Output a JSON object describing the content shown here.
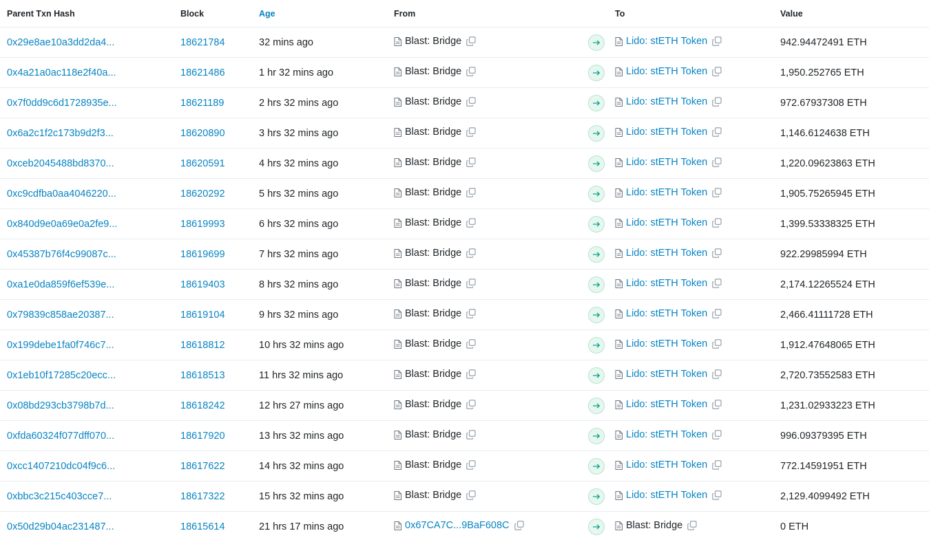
{
  "table": {
    "headers": {
      "hash": "Parent Txn Hash",
      "block": "Block",
      "age": "Age",
      "from": "From",
      "to": "To",
      "value": "Value"
    },
    "rows": [
      {
        "hash": "0x29e8ae10a3dd2da4...",
        "block": "18621784",
        "age": "32 mins ago",
        "from": "Blast: Bridge",
        "from_is_link": false,
        "to": "Lido: stETH Token",
        "to_is_link": true,
        "value": "942.94472491 ETH"
      },
      {
        "hash": "0x4a21a0ac118e2f40a...",
        "block": "18621486",
        "age": "1 hr 32 mins ago",
        "from": "Blast: Bridge",
        "from_is_link": false,
        "to": "Lido: stETH Token",
        "to_is_link": true,
        "value": "1,950.252765 ETH"
      },
      {
        "hash": "0x7f0dd9c6d1728935e...",
        "block": "18621189",
        "age": "2 hrs 32 mins ago",
        "from": "Blast: Bridge",
        "from_is_link": false,
        "to": "Lido: stETH Token",
        "to_is_link": true,
        "value": "972.67937308 ETH"
      },
      {
        "hash": "0x6a2c1f2c173b9d2f3...",
        "block": "18620890",
        "age": "3 hrs 32 mins ago",
        "from": "Blast: Bridge",
        "from_is_link": false,
        "to": "Lido: stETH Token",
        "to_is_link": true,
        "value": "1,146.6124638 ETH"
      },
      {
        "hash": "0xceb2045488bd8370...",
        "block": "18620591",
        "age": "4 hrs 32 mins ago",
        "from": "Blast: Bridge",
        "from_is_link": false,
        "to": "Lido: stETH Token",
        "to_is_link": true,
        "value": "1,220.09623863 ETH"
      },
      {
        "hash": "0xc9cdfba0aa4046220...",
        "block": "18620292",
        "age": "5 hrs 32 mins ago",
        "from": "Blast: Bridge",
        "from_is_link": false,
        "to": "Lido: stETH Token",
        "to_is_link": true,
        "value": "1,905.75265945 ETH"
      },
      {
        "hash": "0x840d9e0a69e0a2fe9...",
        "block": "18619993",
        "age": "6 hrs 32 mins ago",
        "from": "Blast: Bridge",
        "from_is_link": false,
        "to": "Lido: stETH Token",
        "to_is_link": true,
        "value": "1,399.53338325 ETH"
      },
      {
        "hash": "0x45387b76f4c99087c...",
        "block": "18619699",
        "age": "7 hrs 32 mins ago",
        "from": "Blast: Bridge",
        "from_is_link": false,
        "to": "Lido: stETH Token",
        "to_is_link": true,
        "value": "922.29985994 ETH"
      },
      {
        "hash": "0xa1e0da859f6ef539e...",
        "block": "18619403",
        "age": "8 hrs 32 mins ago",
        "from": "Blast: Bridge",
        "from_is_link": false,
        "to": "Lido: stETH Token",
        "to_is_link": true,
        "value": "2,174.12265524 ETH"
      },
      {
        "hash": "0x79839c858ae20387...",
        "block": "18619104",
        "age": "9 hrs 32 mins ago",
        "from": "Blast: Bridge",
        "from_is_link": false,
        "to": "Lido: stETH Token",
        "to_is_link": true,
        "value": "2,466.41111728 ETH"
      },
      {
        "hash": "0x199debe1fa0f746c7...",
        "block": "18618812",
        "age": "10 hrs 32 mins ago",
        "from": "Blast: Bridge",
        "from_is_link": false,
        "to": "Lido: stETH Token",
        "to_is_link": true,
        "value": "1,912.47648065 ETH"
      },
      {
        "hash": "0x1eb10f17285c20ecc...",
        "block": "18618513",
        "age": "11 hrs 32 mins ago",
        "from": "Blast: Bridge",
        "from_is_link": false,
        "to": "Lido: stETH Token",
        "to_is_link": true,
        "value": "2,720.73552583 ETH"
      },
      {
        "hash": "0x08bd293cb3798b7d...",
        "block": "18618242",
        "age": "12 hrs 27 mins ago",
        "from": "Blast: Bridge",
        "from_is_link": false,
        "to": "Lido: stETH Token",
        "to_is_link": true,
        "value": "1,231.02933223 ETH"
      },
      {
        "hash": "0xfda60324f077dff070...",
        "block": "18617920",
        "age": "13 hrs 32 mins ago",
        "from": "Blast: Bridge",
        "from_is_link": false,
        "to": "Lido: stETH Token",
        "to_is_link": true,
        "value": "996.09379395 ETH"
      },
      {
        "hash": "0xcc1407210dc04f9c6...",
        "block": "18617622",
        "age": "14 hrs 32 mins ago",
        "from": "Blast: Bridge",
        "from_is_link": false,
        "to": "Lido: stETH Token",
        "to_is_link": true,
        "value": "772.14591951 ETH"
      },
      {
        "hash": "0xbbc3c215c403cce7...",
        "block": "18617322",
        "age": "15 hrs 32 mins ago",
        "from": "Blast: Bridge",
        "from_is_link": false,
        "to": "Lido: stETH Token",
        "to_is_link": true,
        "value": "2,129.4099492 ETH"
      },
      {
        "hash": "0x50d29b04ac231487...",
        "block": "18615614",
        "age": "21 hrs 17 mins ago",
        "from": "0x67CA7C...9BaF608C",
        "from_is_link": true,
        "to": "Blast: Bridge",
        "to_is_link": false,
        "value": "0 ETH"
      }
    ]
  },
  "icons": {
    "doc": "contract-document-icon",
    "copy": "copy-icon",
    "direction": "arrow-right-icon"
  },
  "colors": {
    "link": "#0784c3",
    "text": "#212529",
    "arrow_bg": "#e6f7ef",
    "arrow_fg": "#00a186"
  }
}
